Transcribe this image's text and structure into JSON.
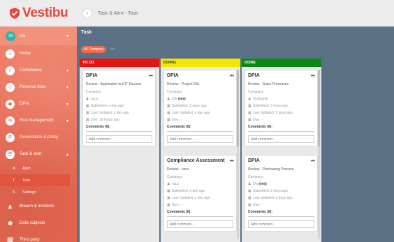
{
  "app": {
    "logo_text": "Vestibu"
  },
  "header": {
    "crumb_icon": "i",
    "breadcrumb": "Task & Alert - Task"
  },
  "sidebar": {
    "user": {
      "initials": "JW",
      "name": "Ola"
    },
    "items": [
      {
        "label": "Home",
        "icon": "home-icon",
        "glyph": "⌂"
      },
      {
        "label": "Compliance",
        "icon": "compliance-icon",
        "glyph": "✓",
        "caret": "▾"
      },
      {
        "label": "Personal data",
        "icon": "person-icon",
        "glyph": "☺",
        "caret": "▾"
      },
      {
        "label": "DPIA",
        "icon": "shield-icon",
        "glyph": "◆",
        "caret": "▾"
      },
      {
        "label": "Risk management",
        "icon": "risk-icon",
        "glyph": "%",
        "caret": "▾"
      },
      {
        "label": "Governance & policy",
        "icon": "policy-icon",
        "glyph": "P"
      },
      {
        "label": "Task & alert",
        "icon": "task-icon",
        "glyph": "☰",
        "caret": "▴"
      }
    ],
    "sub_items": [
      {
        "letter": "A",
        "label": "Alert"
      },
      {
        "letter": "T",
        "label": "Task"
      },
      {
        "letter": "S",
        "label": "Settings"
      }
    ],
    "bottom_items": [
      {
        "label": "Breach & incidents",
        "icon": "warning-icon",
        "glyph": "▲"
      },
      {
        "label": "Data subjects",
        "icon": "people-icon",
        "glyph": "☻"
      },
      {
        "label": "Third party",
        "icon": "building-icon",
        "glyph": "▦"
      }
    ]
  },
  "main": {
    "title": "Task",
    "filter_active": "All Company",
    "filter_other": "Mo"
  },
  "columns": [
    {
      "title": "TO DO",
      "color": "#e8120e",
      "cards": [
        {
          "title": "DPIA",
          "subtitle": "Review - Application to IOT Devices",
          "company": "Company:",
          "user": "ozcz",
          "me": "",
          "submitted": "Submitted: a day ago",
          "updated": "Last Updated: a day ago",
          "due": "Due: 19 hours ago",
          "comments": "Comments (0):",
          "placeholder": "Add comment..."
        }
      ]
    },
    {
      "title": "DOING",
      "color": "#f1e800",
      "cards": [
        {
          "title": "DPIA",
          "subtitle": "Review - Project Rile",
          "company": "Company:",
          "user": "Ola",
          "me": "(me)",
          "submitted": "Submitted: 2 days ago",
          "updated": "Last Updated: a day ago",
          "due": "Due: -",
          "comments": "Comments (0):",
          "placeholder": "Add comment..."
        },
        {
          "title": "Compliance Assessment",
          "subtitle": "Review - ozcz",
          "company": "Company:",
          "user": "ozcz",
          "me": "",
          "submitted": "Submitted: a day ago",
          "updated": "Last Updated: a day ago",
          "due": "Due: -",
          "comments": "Comments (0):",
          "placeholder": "Add comment..."
        }
      ]
    },
    {
      "title": "DONE",
      "color": "#0a8a14",
      "cards": [
        {
          "title": "DPIA",
          "subtitle": "Review - Sales Processes",
          "company": "Company:",
          "user": "Testing12",
          "me": "",
          "submitted": "Submitted: 2 days ago",
          "updated": "Last Updated: 2 days ago",
          "due": "Due: -",
          "comments": "Comments (0):",
          "placeholder": "Add comment..."
        },
        {
          "title": "DPIA",
          "subtitle": "Review - Purchasing Process",
          "company": "Company:",
          "user": "Ola",
          "me": "(me)",
          "submitted": "Submitted: 2 days ago",
          "updated": "Last Updated: 2 days ago",
          "due": "Due: -",
          "comments": "Comments (0):",
          "placeholder": "Add comment..."
        }
      ]
    }
  ]
}
